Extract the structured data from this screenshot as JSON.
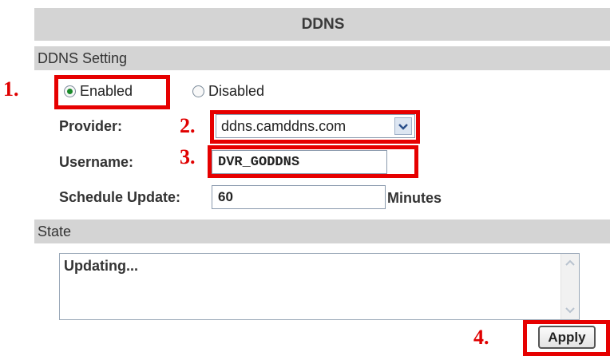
{
  "title": "DDNS",
  "ddns_setting": {
    "section_label": "DDNS Setting",
    "enabled_label": "Enabled",
    "disabled_label": "Disabled",
    "selected": "Enabled",
    "provider_label": "Provider:",
    "provider_value": "ddns.camddns.com",
    "username_label": "Username:",
    "username_value": "DVR_GODDNS",
    "schedule_label": "Schedule Update:",
    "schedule_value": "60",
    "schedule_units": "Minutes"
  },
  "state": {
    "section_label": "State",
    "text": "Updating..."
  },
  "apply_label": "Apply",
  "steps": [
    "1.",
    "2.",
    "3.",
    "4."
  ],
  "colors": {
    "highlight": "#e60000",
    "header_bg": "#d4d4d4",
    "radio_dot": "#1a8a2a"
  }
}
